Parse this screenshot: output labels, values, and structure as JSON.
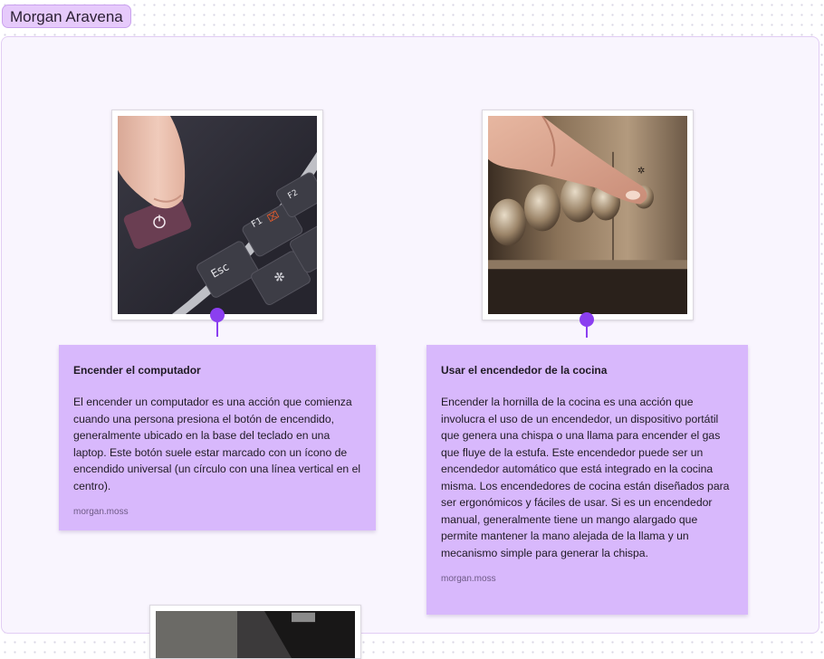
{
  "frame": {
    "title": "Morgan Aravena"
  },
  "cards": [
    {
      "title": "Encender el computador",
      "body": "El encender un computador es una acción que comienza cuando una persona presiona el botón de encendido, generalmente ubicado en la base del teclado en una laptop. Este botón suele estar marcado con un ícono de encendido universal (un círculo con una línea vertical en el centro).",
      "author": "morgan.moss",
      "keys": {
        "f1": "F1",
        "f2": "F2",
        "esc": "Esc"
      }
    },
    {
      "title": "Usar el encendedor de la cocina",
      "body": "Encender la hornilla de la cocina es una acción que involucra el uso de un encendedor, un dispositivo portátil que genera una chispa o una llama para encender el gas que fluye de la estufa. Este encendedor puede ser un encendedor automático que está integrado en la cocina misma. Los encendedores de cocina están diseñados para ser ergonómicos y fáciles de usar. Si es un encendedor manual, generalmente tiene un mango alargado que permite mantener la mano alejada de la llama y un mecanismo simple para generar la chispa.",
      "author": "morgan.moss"
    }
  ],
  "colors": {
    "note": "#d8b8fc",
    "pin": "#8b3ff0",
    "frame_label": "#e6cafb"
  }
}
